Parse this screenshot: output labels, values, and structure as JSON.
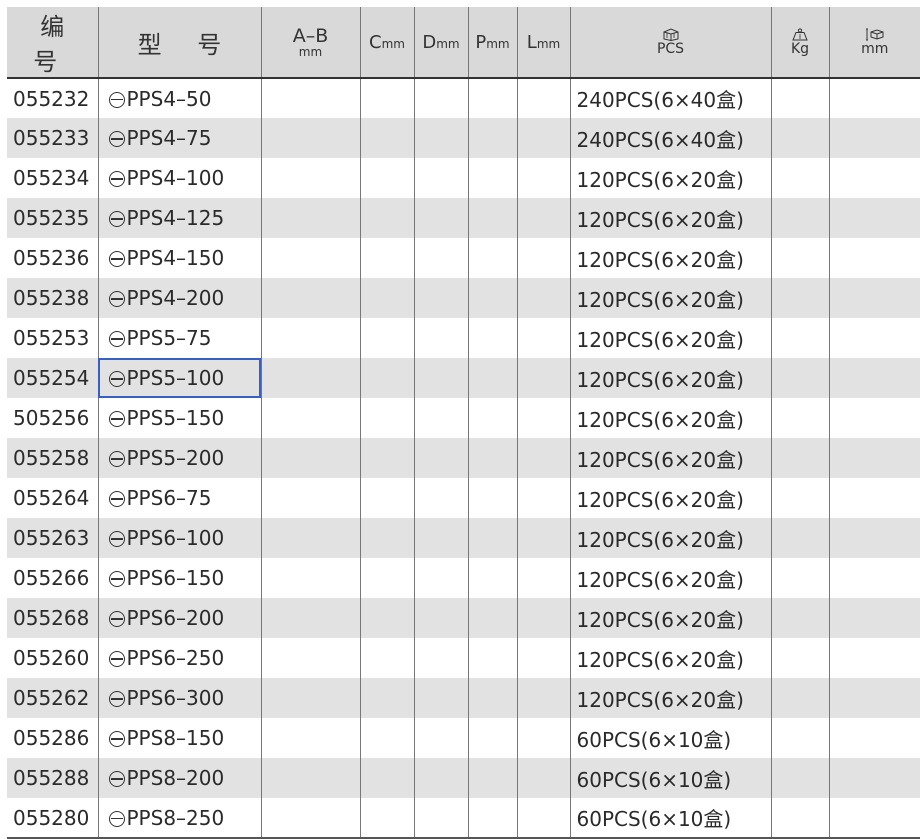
{
  "headers": {
    "code": "编 号",
    "model": "型 号",
    "ab_top": "A–B",
    "ab_unit": "mm",
    "c": "C",
    "d": "D",
    "p": "P",
    "l": "L",
    "unit_mm": "mm",
    "pcs": "PCS",
    "kg": "Kg",
    "size_unit": "mm",
    "icons": [
      "box-icon",
      "weight-icon",
      "dimension-icon"
    ]
  },
  "rows": [
    {
      "code": "055232",
      "model": "PPS4–50",
      "pcs": "240PCS(6×40盒)"
    },
    {
      "code": "055233",
      "model": "PPS4–75",
      "pcs": "240PCS(6×40盒)"
    },
    {
      "code": "055234",
      "model": "PPS4–100",
      "pcs": "120PCS(6×20盒)"
    },
    {
      "code": "055235",
      "model": "PPS4–125",
      "pcs": "120PCS(6×20盒)"
    },
    {
      "code": "055236",
      "model": "PPS4–150",
      "pcs": "120PCS(6×20盒)"
    },
    {
      "code": "055238",
      "model": "PPS4–200",
      "pcs": "120PCS(6×20盒)"
    },
    {
      "code": "055253",
      "model": "PPS5–75",
      "pcs": "120PCS(6×20盒)"
    },
    {
      "code": "055254",
      "model": "PPS5–100",
      "pcs": "120PCS(6×20盒)"
    },
    {
      "code": "505256",
      "model": "PPS5–150",
      "pcs": "120PCS(6×20盒)"
    },
    {
      "code": "055258",
      "model": "PPS5–200",
      "pcs": "120PCS(6×20盒)"
    },
    {
      "code": "055264",
      "model": "PPS6–75",
      "pcs": "120PCS(6×20盒)"
    },
    {
      "code": "055263",
      "model": "PPS6–100",
      "pcs": "120PCS(6×20盒)"
    },
    {
      "code": "055266",
      "model": "PPS6–150",
      "pcs": "120PCS(6×20盒)"
    },
    {
      "code": "055268",
      "model": "PPS6–200",
      "pcs": "120PCS(6×20盒)"
    },
    {
      "code": "055260",
      "model": "PPS6–250",
      "pcs": "120PCS(6×20盒)"
    },
    {
      "code": "055262",
      "model": "PPS6–300",
      "pcs": "120PCS(6×20盒)"
    },
    {
      "code": "055286",
      "model": "PPS8–150",
      "pcs": "60PCS(6×10盒)"
    },
    {
      "code": "055288",
      "model": "PPS8–200",
      "pcs": "60PCS(6×10盒)"
    },
    {
      "code": "055280",
      "model": "PPS8–250",
      "pcs": "60PCS(6×10盒)"
    }
  ],
  "selected_row": 7,
  "colors": {
    "header_bg": "#d9d9d9",
    "stripe_bg": "#e2e2e2",
    "selection_border": "#3a5fc2"
  }
}
